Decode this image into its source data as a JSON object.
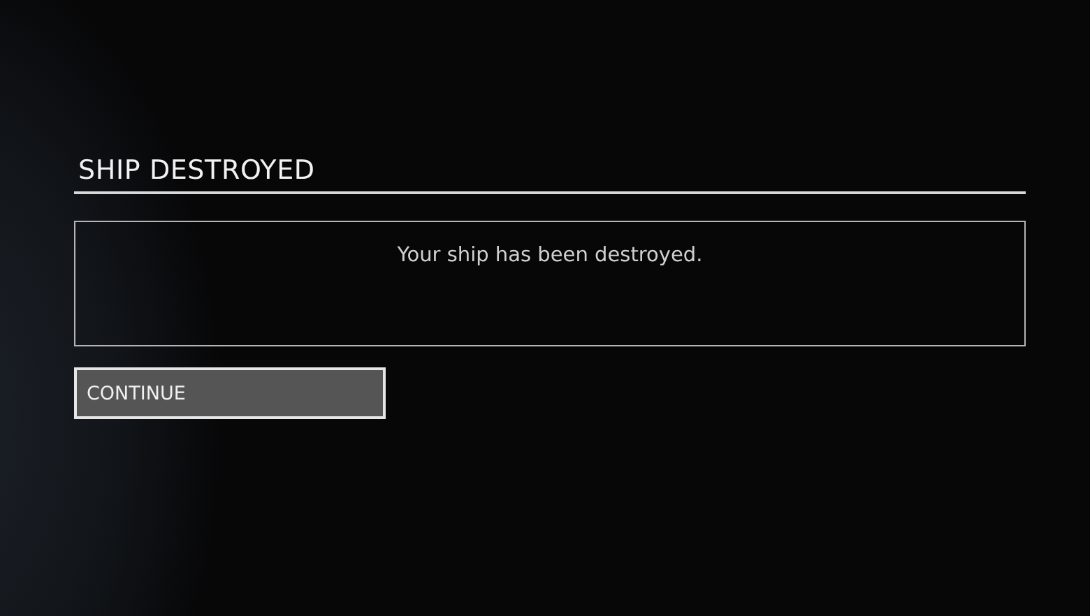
{
  "dialog": {
    "title": "SHIP DESTROYED",
    "message": "Your ship has been destroyed."
  },
  "buttons": [
    {
      "label": "CONTINUE",
      "selected": true
    }
  ]
}
